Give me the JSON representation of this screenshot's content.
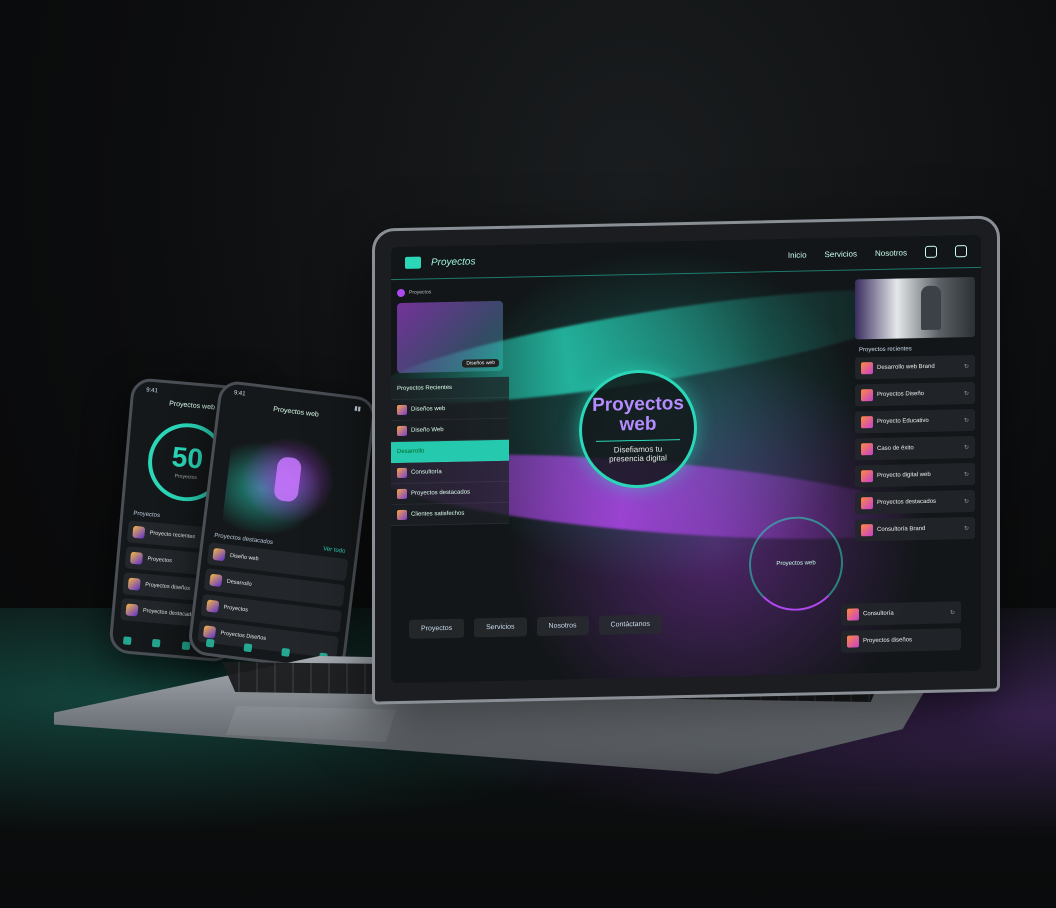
{
  "laptop": {
    "brand": "Proyectos",
    "nav": [
      "Inicio",
      "Servicios",
      "Nosotros"
    ],
    "hero": {
      "title_line1": "Proyectos",
      "title_line2": "web",
      "subtitle": "Disefiamos tu presencia digital"
    },
    "ring_label": "Proyectos web",
    "left_panel": {
      "header": "Proyectos",
      "promo_chip": "Diseños web",
      "rows": [
        {
          "label": "Proyectos Recientes"
        },
        {
          "label": "Diseños web"
        },
        {
          "label": "Diseño Web",
          "active": true
        },
        {
          "label": "Desarrollo"
        },
        {
          "label": "Consultoría"
        },
        {
          "label": "Proyectos destacados"
        },
        {
          "label": "Clientes satisfechos"
        }
      ]
    },
    "right_panel": {
      "title": "Proyectos recientes",
      "rows": [
        {
          "label": "Desarrollo web Brand"
        },
        {
          "label": "Proyectos Diseño"
        },
        {
          "label": "Proyecto Educativo"
        },
        {
          "label": "Caso de éxito"
        },
        {
          "label": "Proyecto digital web"
        },
        {
          "label": "Proyectos destacados"
        },
        {
          "label": "Consultoría Brand"
        }
      ]
    },
    "bottom_tabs": [
      "Proyectos",
      "Servicios",
      "Nosotros",
      "Contáctanos"
    ],
    "bottom_right": [
      {
        "label": "Consultoría"
      },
      {
        "label": "Proyectos diseños"
      }
    ]
  },
  "phone1": {
    "time": "9:41",
    "title": "Proyectos web",
    "score": "50",
    "score_sub": "Proyectos",
    "section": "Proyectos",
    "rows": [
      {
        "label": "Proyecto recientes"
      },
      {
        "label": "Proyectos"
      },
      {
        "label": "Proyectos diseños"
      },
      {
        "label": "Proyectos destacados"
      }
    ]
  },
  "phone2": {
    "time": "9:41",
    "title": "Proyectos web",
    "section": "Proyectos destacados",
    "section_right": "Ver todo",
    "rows": [
      {
        "label": "Diseño web"
      },
      {
        "label": "Desarrollo"
      },
      {
        "label": "Proyectos"
      },
      {
        "label": "Proyectos Diseños"
      }
    ]
  }
}
